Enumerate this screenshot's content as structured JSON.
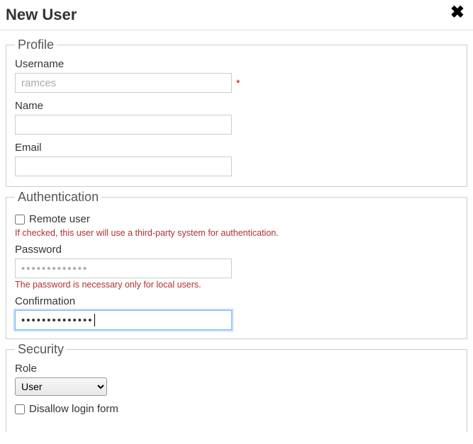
{
  "header": {
    "title": "New User"
  },
  "profile": {
    "legend": "Profile",
    "username_label": "Username",
    "username_value": "ramces",
    "name_label": "Name",
    "name_value": "",
    "email_label": "Email",
    "email_value": ""
  },
  "auth": {
    "legend": "Authentication",
    "remote_label": "Remote user",
    "remote_checked": false,
    "remote_help": "If checked, this user will use a third-party system for authentication.",
    "password_label": "Password",
    "password_value": "•••••••••••••",
    "password_help": "The password is necessary only for local users.",
    "confirmation_label": "Confirmation",
    "confirmation_value": "••••••••••••••"
  },
  "security": {
    "legend": "Security",
    "role_label": "Role",
    "role_value": "User",
    "disallow_label": "Disallow login form",
    "disallow_checked": false
  }
}
